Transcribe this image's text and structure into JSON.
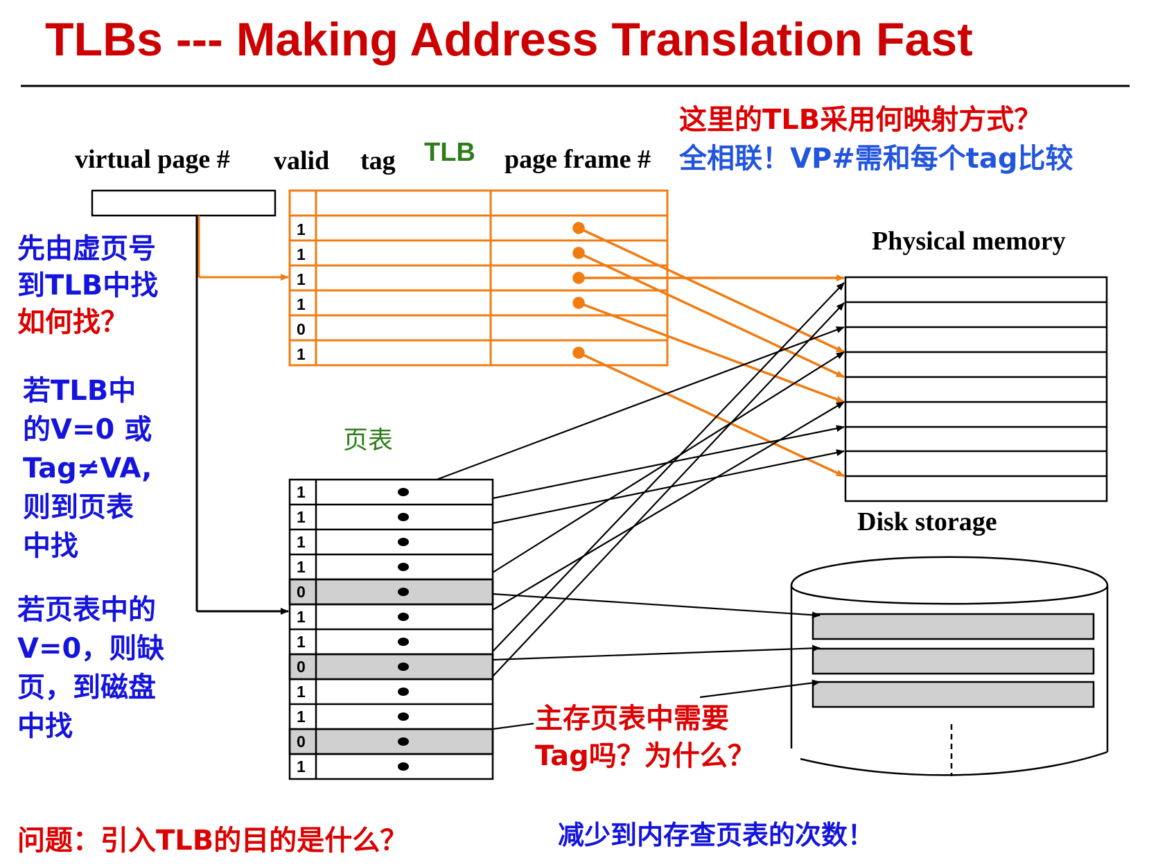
{
  "title": "TLBs --- Making Address Translation Fast",
  "headers": {
    "virtual_page": "virtual page #",
    "valid": "valid",
    "tag": "tag",
    "tlb": "TLB",
    "page_frame": "page frame #"
  },
  "tlb_valid_bits": [
    "1",
    "1",
    "1",
    "1",
    "0",
    "1"
  ],
  "page_table_label": "页表",
  "page_table_valid_bits": [
    "1",
    "1",
    "1",
    "1",
    "0",
    "1",
    "1",
    "0",
    "1",
    "1",
    "0",
    "1"
  ],
  "physical_memory_label": "Physical memory",
  "disk_storage_label": "Disk storage",
  "question_top": {
    "line1": "这里的TLB采用何映射方式？",
    "line2": "全相联！VP#需和每个tag比较"
  },
  "left_notes": {
    "note1_line1": "先由虚页号",
    "note1_line2": "到TLB中找",
    "note1_line3": "如何找？",
    "note2_line1": "若TLB中",
    "note2_line2": "的V=0 或",
    "note2_line3": "Tag≠VA,",
    "note2_line4": "则到页表",
    "note2_line5": "中找",
    "note3_line1": "若页表中的",
    "note3_line2": "V=0，则缺",
    "note3_line3": "页，到磁盘",
    "note3_line4": "中找"
  },
  "tag_question": {
    "line1": "主存页表中需要",
    "line2": "Tag吗？为什么？"
  },
  "bottom": {
    "question": "问题：引入TLB的目的是什么？",
    "answer": "减少到内存查页表的次数！"
  },
  "colors": {
    "title": "#cc0000",
    "tlb_orange": "#f07c12",
    "blue_text": "#1414dc",
    "red_text": "#dd0000",
    "tlb_label_green": "#2e7d1a",
    "invalid_row": "#d0d0d0"
  }
}
